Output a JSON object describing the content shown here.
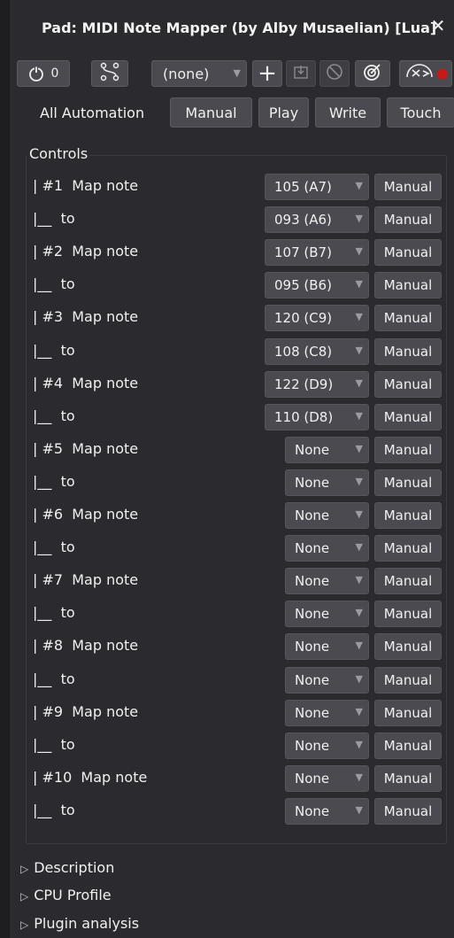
{
  "window": {
    "title": "Pad: MIDI Note Mapper (by Alby Musaelian) [Lua]",
    "close_symbol": "✕"
  },
  "toolbar": {
    "bypass_count": "0",
    "preset_value": "(none)",
    "preset_arrow": "▼",
    "add_symbol": "+",
    "icons": [
      "power-icon",
      "routing-icon",
      "add-icon",
      "save-icon",
      "delete-icon",
      "analysis-icon",
      "latency-icon",
      "record-indicator-icon"
    ]
  },
  "automation": {
    "label": "All Automation",
    "buttons": [
      "Manual",
      "Play",
      "Write",
      "Touch"
    ]
  },
  "controls": {
    "title": "Controls",
    "rows": [
      {
        "label": "| #1  Map note",
        "value": "105 (A7)",
        "mode": "Manual"
      },
      {
        "label": "|__  to",
        "value": "093 (A6)",
        "mode": "Manual"
      },
      {
        "label": "| #2  Map note",
        "value": "107 (B7)",
        "mode": "Manual"
      },
      {
        "label": "|__  to",
        "value": "095 (B6)",
        "mode": "Manual"
      },
      {
        "label": "| #3  Map note",
        "value": "120 (C9)",
        "mode": "Manual"
      },
      {
        "label": "|__  to",
        "value": "108 (C8)",
        "mode": "Manual"
      },
      {
        "label": "| #4  Map note",
        "value": "122 (D9)",
        "mode": "Manual"
      },
      {
        "label": "|__  to",
        "value": "110 (D8)",
        "mode": "Manual"
      },
      {
        "label": "| #5  Map note",
        "value": "None",
        "mode": "Manual"
      },
      {
        "label": "|__  to",
        "value": "None",
        "mode": "Manual"
      },
      {
        "label": "| #6  Map note",
        "value": "None",
        "mode": "Manual"
      },
      {
        "label": "|__  to",
        "value": "None",
        "mode": "Manual"
      },
      {
        "label": "| #7  Map note",
        "value": "None",
        "mode": "Manual"
      },
      {
        "label": "|__  to",
        "value": "None",
        "mode": "Manual"
      },
      {
        "label": "| #8  Map note",
        "value": "None",
        "mode": "Manual"
      },
      {
        "label": "|__  to",
        "value": "None",
        "mode": "Manual"
      },
      {
        "label": "| #9  Map note",
        "value": "None",
        "mode": "Manual"
      },
      {
        "label": "|__  to",
        "value": "None",
        "mode": "Manual"
      },
      {
        "label": "| #10  Map note",
        "value": "None",
        "mode": "Manual"
      },
      {
        "label": "|__  to",
        "value": "None",
        "mode": "Manual"
      }
    ]
  },
  "sections": [
    {
      "label": "Description",
      "icon": "expand-triangle-icon"
    },
    {
      "label": "CPU Profile",
      "icon": "expand-triangle-icon"
    },
    {
      "label": "Plugin analysis",
      "icon": "expand-triangle-icon"
    }
  ],
  "colors": {
    "background": "#2b2b2f",
    "button": "#4a4a50",
    "record": "#d02020"
  }
}
